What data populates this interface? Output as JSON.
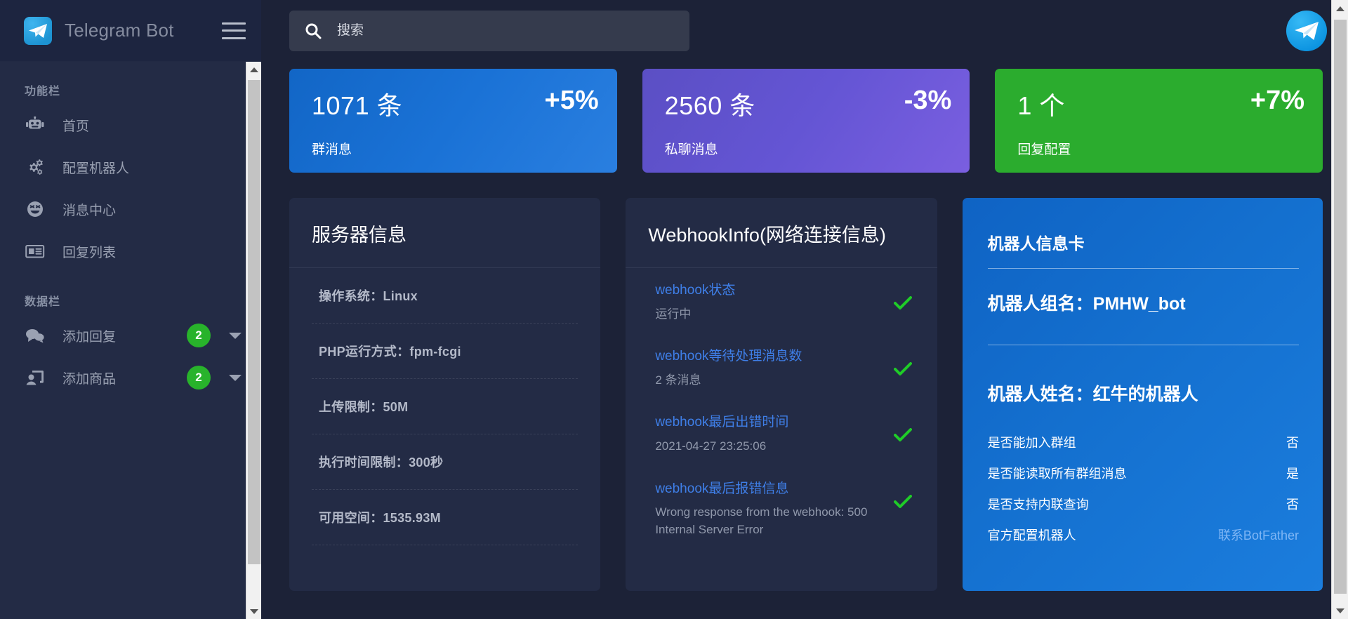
{
  "brand": {
    "title": "Telegram Bot",
    "logo_icon": "telegram-logo-icon",
    "menu_icon": "hamburger-menu-icon"
  },
  "sidebar": {
    "sections": [
      {
        "label": "功能栏",
        "items": [
          {
            "label": "首页",
            "icon": "robot-icon"
          },
          {
            "label": "配置机器人",
            "icon": "gears-icon"
          },
          {
            "label": "消息中心",
            "icon": "emoji-face-icon"
          },
          {
            "label": "回复列表",
            "icon": "newspaper-icon"
          }
        ]
      },
      {
        "label": "数据栏",
        "items": [
          {
            "label": "添加回复",
            "icon": "chat-bubbles-icon",
            "badge": "2",
            "caret": "chevron-down-icon"
          },
          {
            "label": "添加商品",
            "icon": "user-card-icon",
            "badge": "2",
            "caret": "chevron-down-icon"
          }
        ]
      }
    ]
  },
  "topbar": {
    "search_placeholder": "搜索",
    "search_value": "",
    "search_icon": "search-icon",
    "avatar_icon": "telegram-avatar-icon"
  },
  "stats": [
    {
      "value": "1071 条",
      "delta": "+5%",
      "label": "群消息",
      "color": "#1a72d6"
    },
    {
      "value": "2560 条",
      "delta": "-3%",
      "label": "私聊消息",
      "color": "#6455d4"
    },
    {
      "value": "1 个",
      "delta": "+7%",
      "label": "回复配置",
      "color": "#2bac2e"
    }
  ],
  "server_panel": {
    "title": "服务器信息",
    "items": [
      "操作系统：Linux",
      "PHP运行方式：fpm-fcgi",
      "上传限制：50M",
      "执行时间限制：300秒",
      "可用空间：1535.93M"
    ]
  },
  "webhook_panel": {
    "title": "WebhookInfo(网络连接信息)",
    "items": [
      {
        "title": "webhook状态",
        "sub": "运行中",
        "status": "check-icon"
      },
      {
        "title": "webhook等待处理消息数",
        "sub": "2 条消息",
        "status": "check-icon"
      },
      {
        "title": "webhook最后出错时间",
        "sub": "2021-04-27 23:25:06",
        "status": "check-icon"
      },
      {
        "title": "webhook最后报错信息",
        "sub": "Wrong response from the webhook: 500 Internal Server Error",
        "status": "check-icon"
      }
    ]
  },
  "bot_panel": {
    "title": "机器人信息卡",
    "group_name": "机器人组名：PMHW_bot",
    "bot_name": "机器人姓名：红牛的机器人",
    "rows": [
      {
        "key": "是否能加入群组",
        "value": "否",
        "link": false
      },
      {
        "key": "是否能读取所有群组消息",
        "value": "是",
        "link": false
      },
      {
        "key": "是否支持内联查询",
        "value": "否",
        "link": false
      },
      {
        "key": "官方配置机器人",
        "value": "联系BotFather",
        "link": true
      }
    ]
  },
  "scrollbars": {
    "up_icon": "chevron-up-icon",
    "down_icon": "chevron-down-icon"
  }
}
